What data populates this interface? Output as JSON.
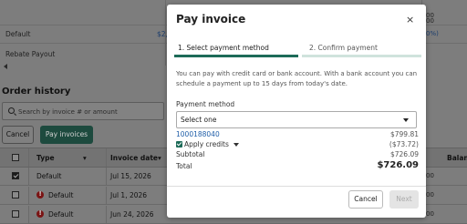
{
  "background": {
    "top_rows": [
      {
        "label": "Default",
        "value": "$2,",
        "right": "0%)"
      },
      {
        "label": "Rebate Payout",
        "value": "",
        "right": ""
      }
    ],
    "top_right_values": [
      "00",
      "00"
    ],
    "order_history_title": "Order history",
    "search_placeholder": "Search by invoice # or amount",
    "cancel_label": "Cancel",
    "pay_invoices_label": "Pay invoices",
    "table": {
      "headers": [
        "Type",
        "Invoice date",
        "Balan"
      ],
      "rows": [
        {
          "type": "Default",
          "date": "Jul 15, 2026",
          "checked": true,
          "error": false,
          "right": "00"
        },
        {
          "type": "Default",
          "date": "Jul 1, 2026",
          "checked": false,
          "error": true,
          "right": "00"
        },
        {
          "type": "Default",
          "date": "Jun 24, 2026",
          "checked": false,
          "error": true,
          "right": "00"
        }
      ]
    }
  },
  "modal": {
    "title": "Pay invoice",
    "close": "×",
    "steps": [
      {
        "num": "1.",
        "label": "Select payment method"
      },
      {
        "num": "2.",
        "label": "Confirm payment"
      }
    ],
    "description": "You can pay with credit card or bank account. With a bank account you can schedule a payment up to 15 days from today's date.",
    "payment_method_label": "Payment method",
    "payment_method_value": "Select one",
    "invoice_number": "1000188040",
    "invoice_amount": "$799.81",
    "apply_credits_label": "Apply credits",
    "apply_credits_amount": "($73.72)",
    "subtotal_label": "Subtotal",
    "subtotal_amount": "$726.09",
    "total_label": "Total",
    "total_amount": "$726.09",
    "cancel_label": "Cancel",
    "next_label": "Next"
  },
  "colors": {
    "accent": "#1d6b58",
    "link": "#1f5ea8",
    "error": "#7a1414"
  }
}
